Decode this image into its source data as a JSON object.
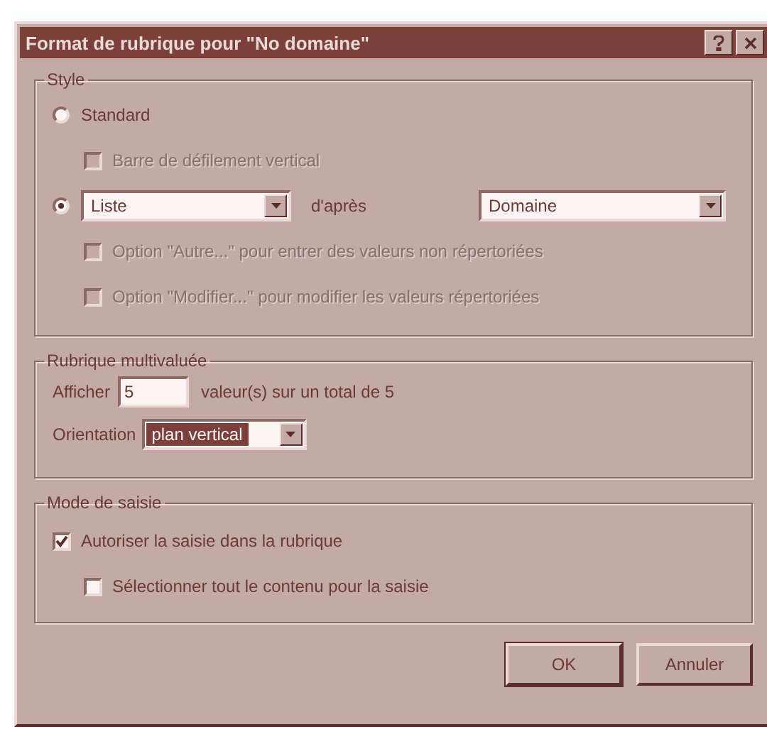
{
  "window": {
    "title": "Format de rubrique pour \"No domaine\""
  },
  "style": {
    "title": "Style",
    "standard": {
      "label": "Standard",
      "selected": false
    },
    "scrollbar_option": {
      "label": "Barre de défilement vertical",
      "checked": false,
      "disabled": true
    },
    "list": {
      "selected": true,
      "type_value": "Liste",
      "after_label": "d'après",
      "source_value": "Domaine"
    },
    "list_options": [
      {
        "label": "Option \"Autre...\" pour entrer des valeurs non répertoriées",
        "checked": false,
        "disabled": true
      },
      {
        "label": "Option \"Modifier...\" pour modifier les valeurs répertoriées",
        "checked": false,
        "disabled": true
      }
    ]
  },
  "multivalue": {
    "title": "Rubrique multivaluée",
    "show_label": "Afficher",
    "show_value": "5",
    "total_text": "valeur(s) sur un total de 5",
    "orientation_label": "Orientation",
    "orientation_value": "plan vertical",
    "orientation_focused": true
  },
  "entry_mode": {
    "title": "Mode de saisie",
    "options": [
      {
        "label": "Autoriser la saisie dans la rubrique",
        "checked": true,
        "disabled": false,
        "children": [
          {
            "label": "Sélectionner tout le contenu pour la saisie",
            "checked": false,
            "disabled": false
          }
        ]
      }
    ]
  },
  "buttons": [
    {
      "label": "OK",
      "default": true
    },
    {
      "label": "Annuler",
      "default": false
    }
  ]
}
